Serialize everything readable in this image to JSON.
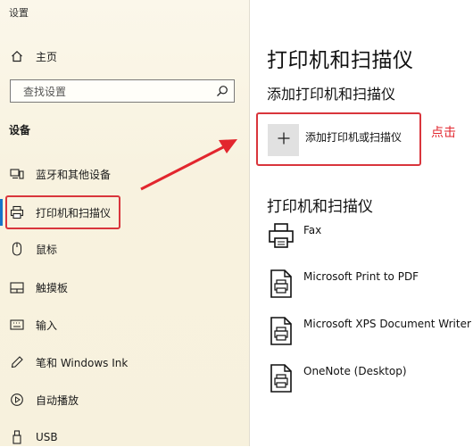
{
  "window": {
    "title": "设置"
  },
  "nav": {
    "home_label": "主页",
    "search_placeholder": "查找设置",
    "section_title": "设备",
    "items": [
      {
        "label": "蓝牙和其他设备",
        "icon": "bluetooth-devices-icon"
      },
      {
        "label": "打印机和扫描仪",
        "icon": "printer-icon",
        "selected": true
      },
      {
        "label": "鼠标",
        "icon": "mouse-icon"
      },
      {
        "label": "触摸板",
        "icon": "touchpad-icon"
      },
      {
        "label": "输入",
        "icon": "keyboard-icon"
      },
      {
        "label": "笔和 Windows Ink",
        "icon": "pen-icon"
      },
      {
        "label": "自动播放",
        "icon": "autoplay-icon"
      },
      {
        "label": "USB",
        "icon": "usb-icon"
      }
    ]
  },
  "main": {
    "title": "打印机和扫描仪",
    "add_section_title": "添加打印机和扫描仪",
    "add_button_label": "添加打印机或扫描仪",
    "list_title": "打印机和扫描仪",
    "devices": [
      {
        "name": "Fax",
        "icon": "fax-printer-icon"
      },
      {
        "name": "Microsoft Print to PDF",
        "icon": "document-printer-icon"
      },
      {
        "name": "Microsoft XPS Document Writer",
        "icon": "document-printer-icon"
      },
      {
        "name": "OneNote (Desktop)",
        "icon": "document-printer-icon"
      }
    ]
  },
  "annotation": {
    "hint": "点击",
    "color": "#e2262e"
  },
  "colors": {
    "highlight_border": "#d9353c",
    "accent": "#1673c9",
    "left_pane_bg": "#f8f2df"
  }
}
